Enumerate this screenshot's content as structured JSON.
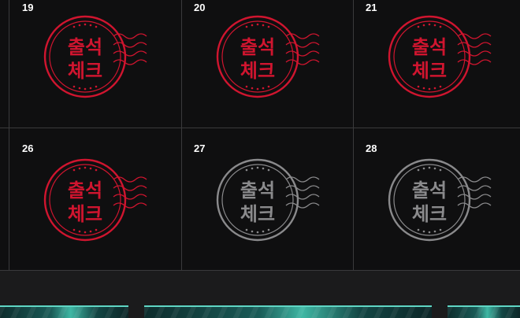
{
  "calendar": {
    "cells": [
      {
        "day": "19",
        "stamped": true,
        "stamp_text_line1": "출석",
        "stamp_text_line2": "체크"
      },
      {
        "day": "20",
        "stamped": true,
        "stamp_text_line1": "출석",
        "stamp_text_line2": "체크"
      },
      {
        "day": "21",
        "stamped": true,
        "stamp_text_line1": "출석",
        "stamp_text_line2": "체크"
      },
      {
        "day": "26",
        "stamped": true,
        "stamp_text_line1": "출석",
        "stamp_text_line2": "체크"
      },
      {
        "day": "27",
        "stamped": false,
        "stamp_text_line1": "출석",
        "stamp_text_line2": "체크"
      },
      {
        "day": "28",
        "stamped": false,
        "stamp_text_line1": "출석",
        "stamp_text_line2": "체크"
      }
    ],
    "colors": {
      "stamped": "#d0152f",
      "unstamped": "#8a8a8c",
      "grid": "#3a3a3c",
      "background": "#0f0f10"
    }
  },
  "banners": [
    {
      "icon": "promo-banner-image"
    },
    {
      "icon": "promo-banner-image"
    },
    {
      "icon": "promo-banner-image"
    }
  ]
}
